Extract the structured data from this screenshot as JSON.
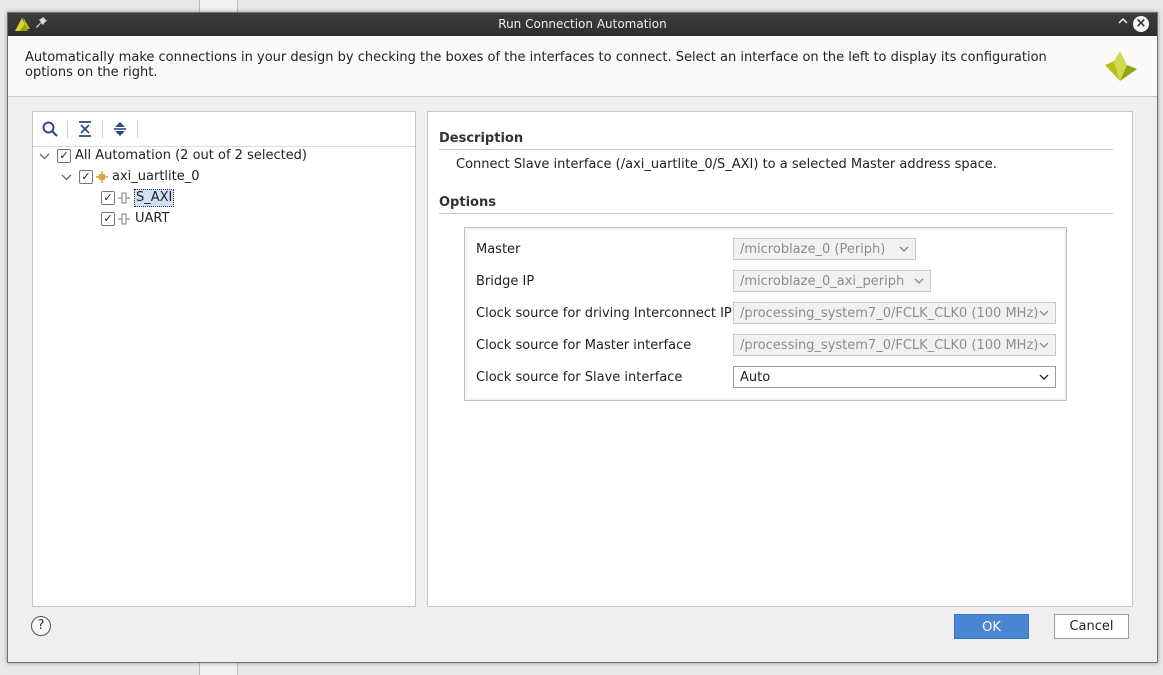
{
  "window": {
    "title": "Run Connection Automation",
    "close_glyph": "×",
    "collapse_glyph": "⌃",
    "pin_glyph": "📌"
  },
  "banner": {
    "text": "Automatically make connections in your design by checking the boxes of the interfaces to connect. Select an interface on the left to display its configuration options on the right."
  },
  "tree": {
    "root": {
      "label": "All Automation (2 out of 2 selected)",
      "checked": true,
      "expanded": true
    },
    "ip": {
      "label": "axi_uartlite_0",
      "checked": true,
      "expanded": true
    },
    "interfaces": [
      {
        "label": "S_AXI",
        "checked": true,
        "selected": true
      },
      {
        "label": "UART",
        "checked": true,
        "selected": false
      }
    ],
    "toolbar_icons": [
      "search-icon",
      "collapse-all-icon",
      "expand-all-icon"
    ]
  },
  "description": {
    "title": "Description",
    "text": "Connect Slave interface (/axi_uartlite_0/S_AXI) to a selected Master address space."
  },
  "options": {
    "title": "Options",
    "rows": [
      {
        "label": "Master",
        "value": "/microblaze_0 (Periph)",
        "enabled": false
      },
      {
        "label": "Bridge IP",
        "value": "/microblaze_0_axi_periph",
        "enabled": false
      },
      {
        "label": "Clock source for driving Interconnect IP",
        "value": "/processing_system7_0/FCLK_CLK0 (100 MHz)",
        "enabled": false
      },
      {
        "label": "Clock source for Master interface",
        "value": "/processing_system7_0/FCLK_CLK0 (100 MHz)",
        "enabled": false
      },
      {
        "label": "Clock source for Slave interface",
        "value": "Auto",
        "enabled": true
      }
    ]
  },
  "buttons": {
    "help": "?",
    "ok": "OK",
    "cancel": "Cancel"
  },
  "colors": {
    "titlebar": "#2e2e2e",
    "ok_button": "#4a86d4",
    "selection": "#cfe1f7",
    "ip_icon": "#e8a33d",
    "logo": "#b5c11f"
  }
}
